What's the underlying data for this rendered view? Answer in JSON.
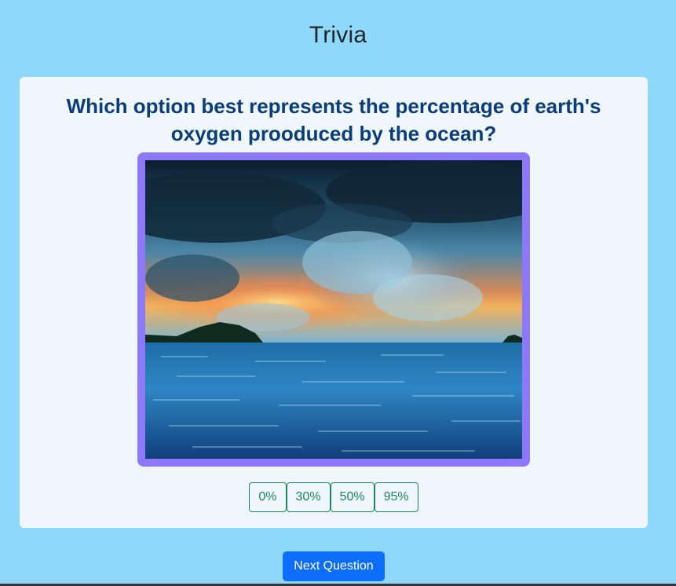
{
  "app": {
    "title": "Trivia"
  },
  "question": {
    "text": "Which option best represents the percentage of earth's oxygen prooduced by the ocean?",
    "image_alt": "Ocean at sunset with dramatic clouds"
  },
  "options": [
    {
      "label": "0%"
    },
    {
      "label": "30%"
    },
    {
      "label": "50%"
    },
    {
      "label": "95%"
    }
  ],
  "actions": {
    "next_label": "Next Question"
  },
  "colors": {
    "background": "#8ed9fb",
    "card": "#eff7fd",
    "question_text": "#0a3d7a",
    "image_border": "#8c78f8",
    "option_accent": "#198754",
    "primary_button": "#0d6efd"
  }
}
